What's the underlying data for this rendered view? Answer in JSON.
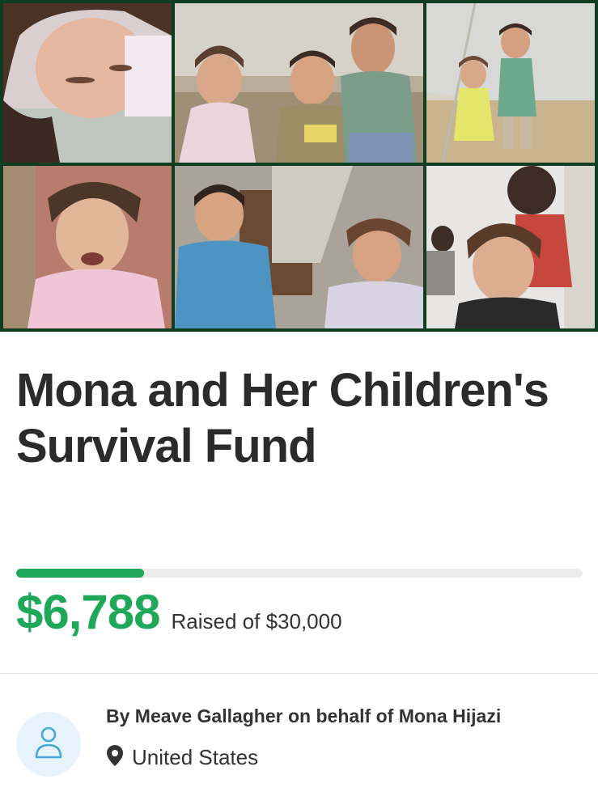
{
  "campaign": {
    "title": "Mona and Her Children's Survival Fund",
    "raised_amount": "$6,788",
    "raised_label": "Raised of $30,000",
    "progress_percent": 22.6
  },
  "organizer": {
    "line": "By Meave Gallagher on behalf of Mona Hijazi",
    "location": "United States"
  },
  "icons": {
    "avatar": "person-icon",
    "location": "map-pin-icon"
  },
  "colors": {
    "accent": "#1fa85a",
    "collage_border": "#0f3d1f",
    "avatar_bg": "#e6f3fb",
    "avatar_icon": "#4aa8d8"
  }
}
